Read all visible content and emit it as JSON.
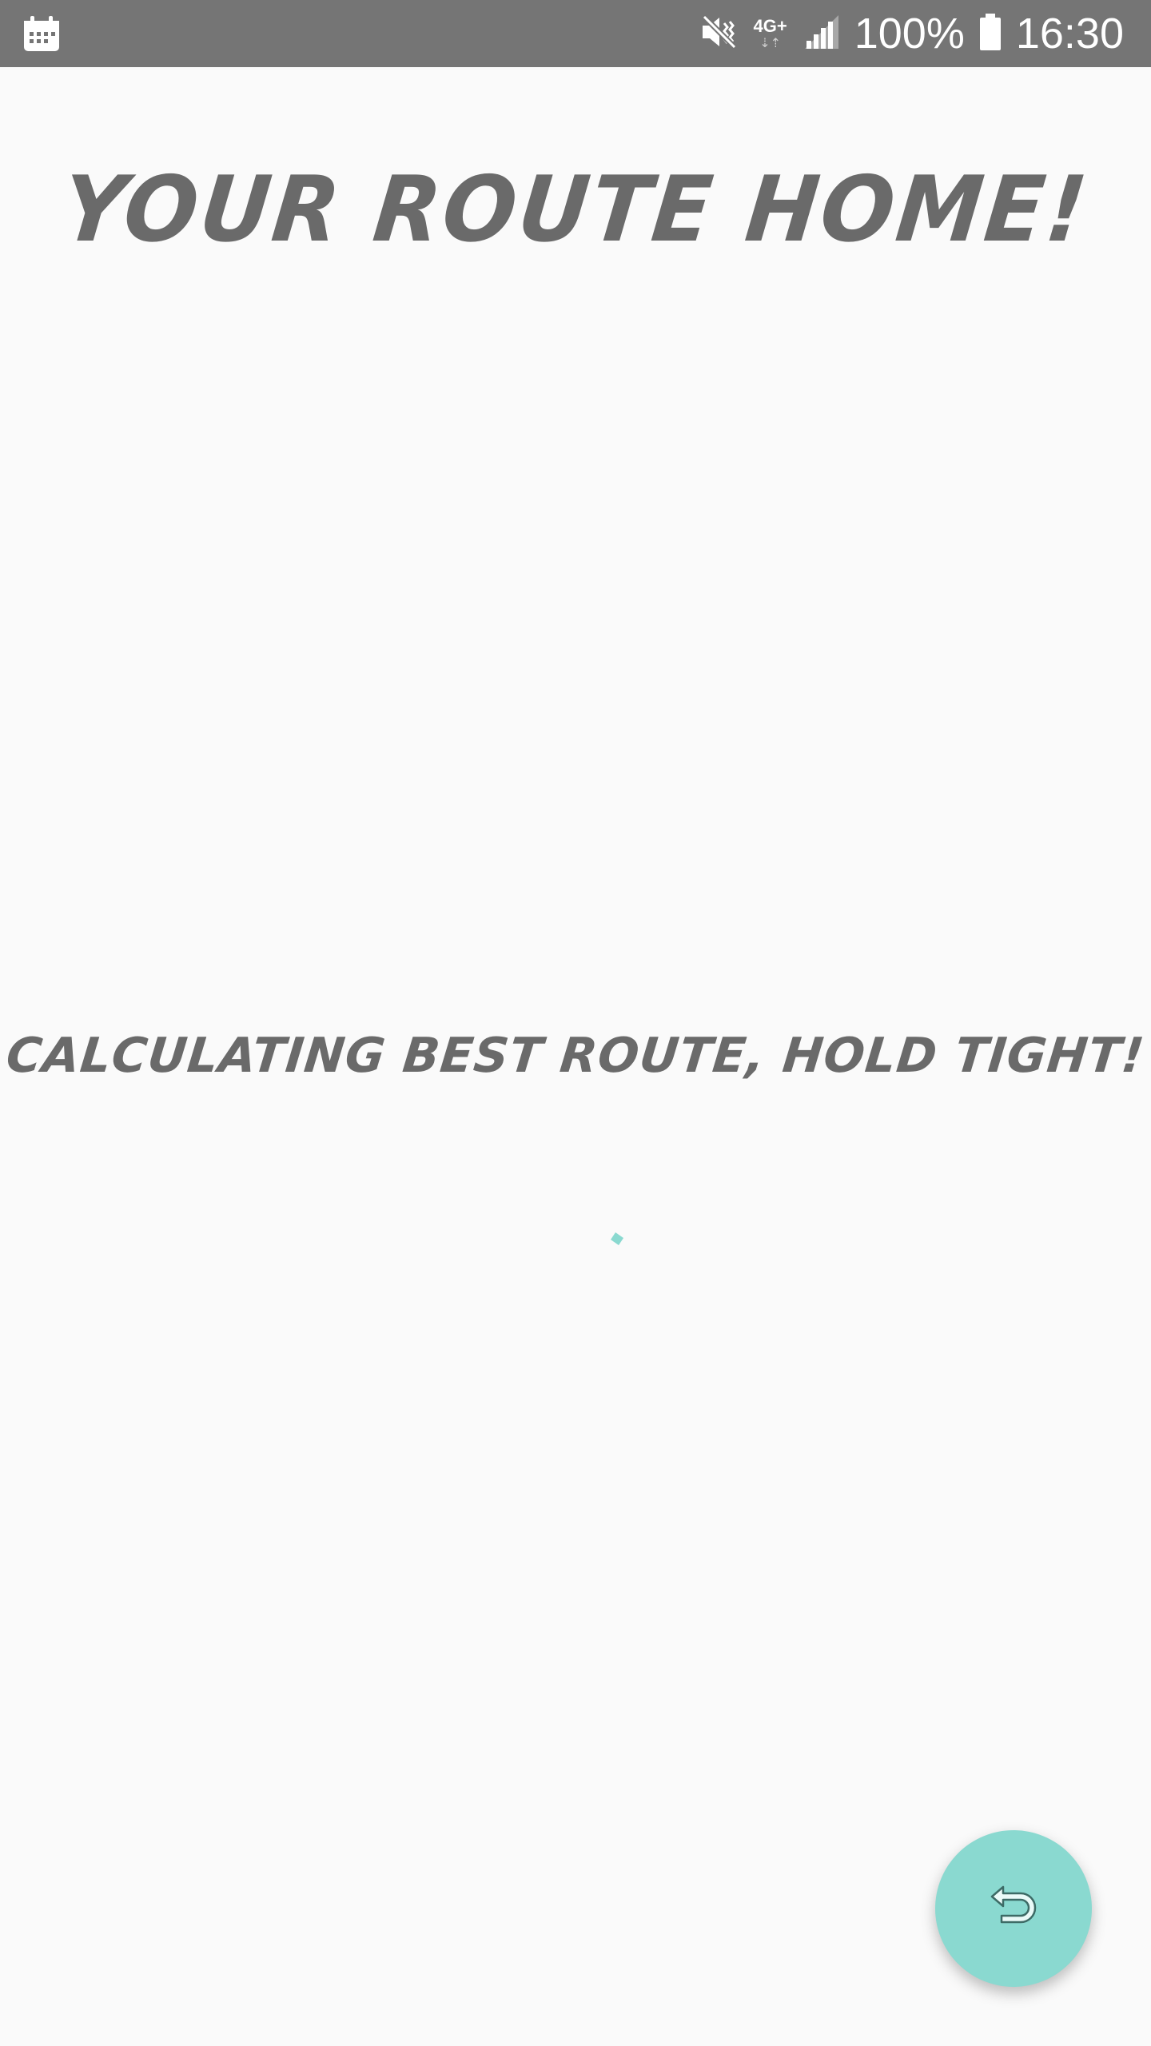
{
  "status_bar": {
    "left_icon": "calendar-icon",
    "icons": [
      "mute-icon",
      "network-type-icon",
      "signal-icon",
      "battery-icon"
    ],
    "network_type": "4G+",
    "network_arrows": "⇣⇡",
    "battery": "100%",
    "time": "16:30",
    "background": "#757575"
  },
  "main": {
    "title": "YOUR ROUTE HOME!",
    "loading_message": "CALCULATING BEST ROUTE, HOLD TIGHT!",
    "spinner_icon": "loading-spinner-icon",
    "accent_color": "#8ad9d0",
    "text_color": "#6a6a6a"
  },
  "fab": {
    "icon": "return-arrow-icon",
    "color": "#8ad9d0"
  }
}
